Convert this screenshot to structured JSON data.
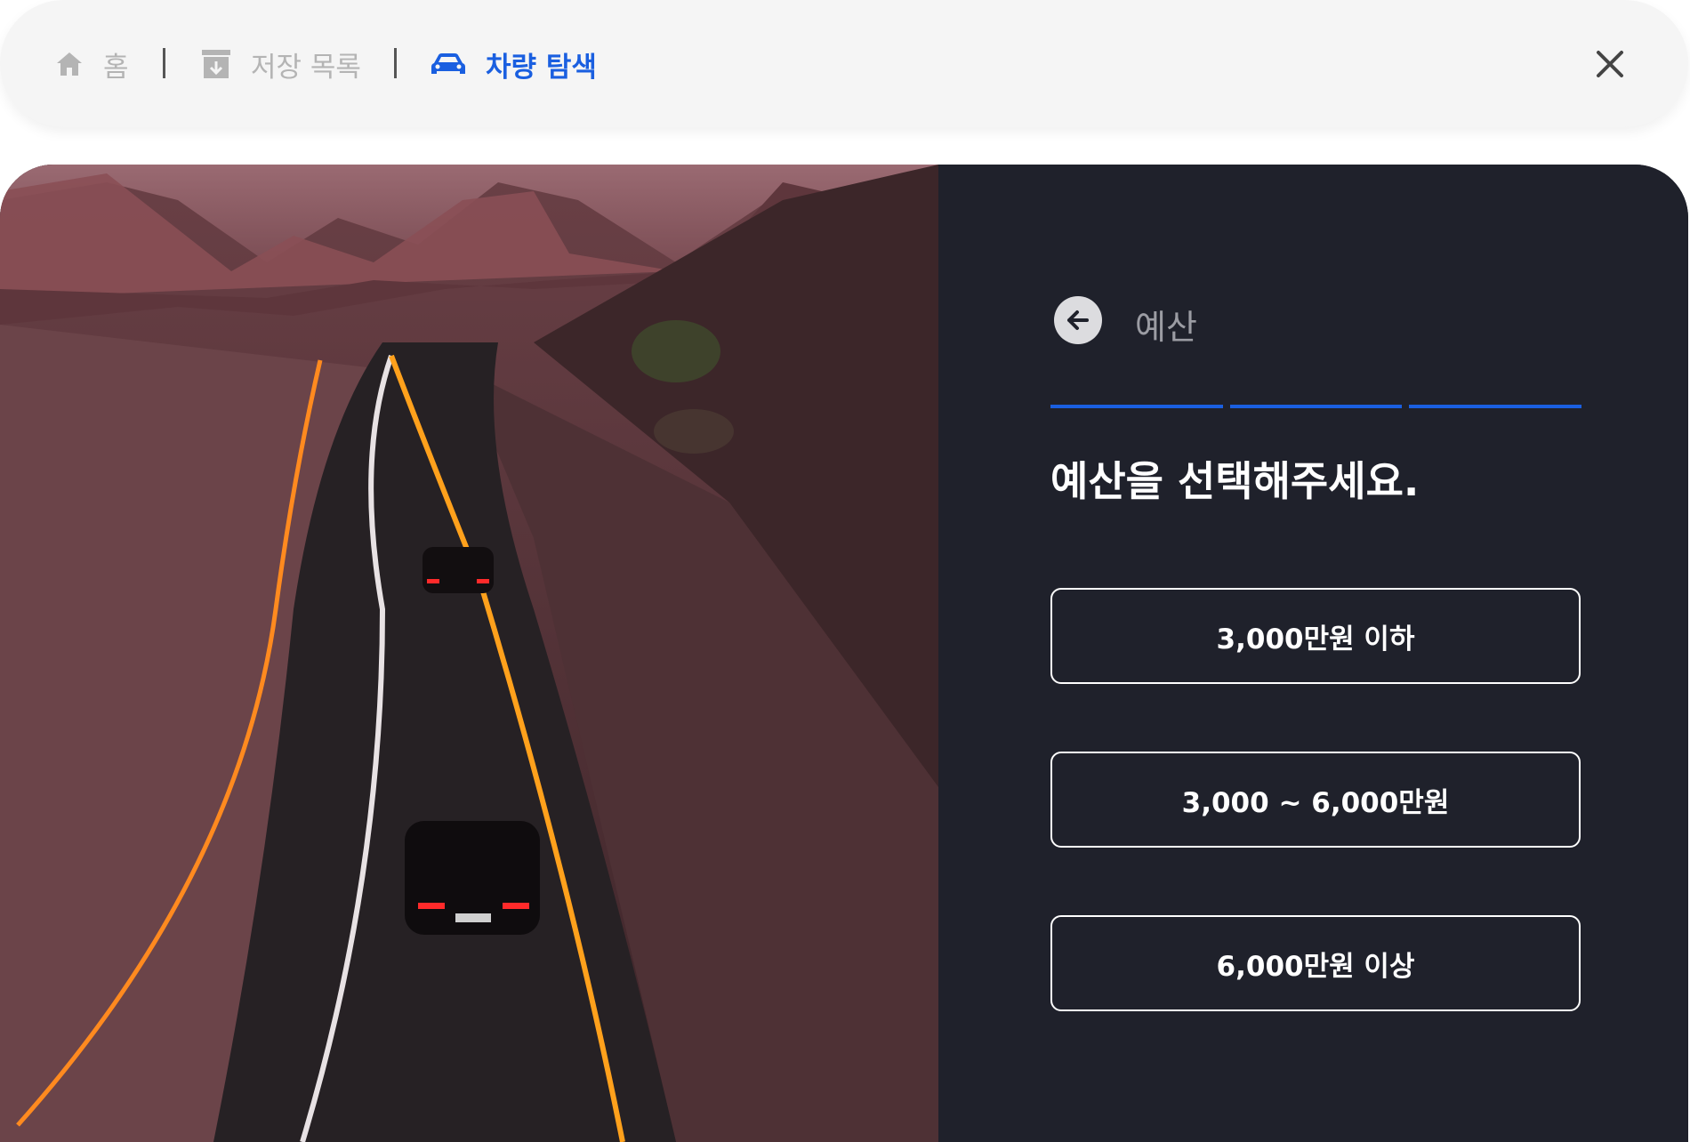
{
  "nav": {
    "home_label": "홈",
    "saved_label": "저장 목록",
    "explore_label": "차량 탐색",
    "active_color": "#1a5fe0",
    "inactive_color": "#b4b4b4"
  },
  "panel": {
    "step_title": "예산",
    "question": "예산을 선택해주세요.",
    "progress_steps_filled": 3,
    "progress_steps_total": 3,
    "options": [
      {
        "label": "3,000만원 이하"
      },
      {
        "label": "3,000 ~ 6,000만원"
      },
      {
        "label": "6,000만원 이상"
      }
    ]
  },
  "icons": {
    "home": "home-icon",
    "saved": "archive-icon",
    "explore": "car-icon",
    "close": "close-icon",
    "back": "arrow-left-icon"
  },
  "colors": {
    "panel_bg": "#1f212b",
    "accent": "#1a5fe0",
    "topbar_bg": "#f5f5f5"
  }
}
